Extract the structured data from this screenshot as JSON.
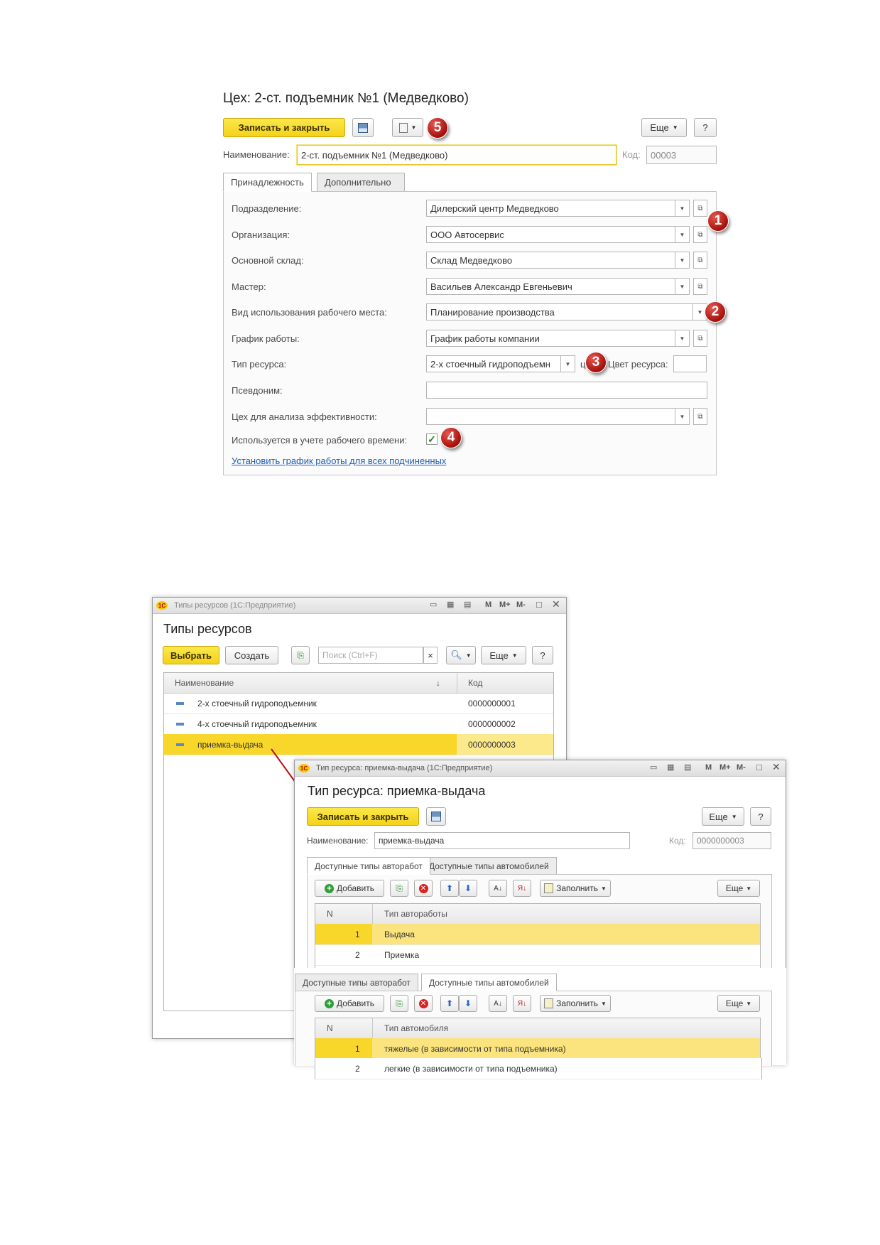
{
  "form1": {
    "title": "Цех: 2-ст. подъемник №1 (Медведково)",
    "save_close_label": "Записать и закрыть",
    "more_label": "Еще",
    "help_label": "?",
    "name_label": "Наименование:",
    "name_value": "2-ст. подъемник №1 (Медведково)",
    "code_label": "Код:",
    "code_value": "00003",
    "tabs": [
      "Принадлежность",
      "Дополнительно"
    ],
    "fields": [
      {
        "label": "Подразделение:",
        "value": "Дилерский центр Медведково"
      },
      {
        "label": "Организация:",
        "value": "ООО Автосервис"
      },
      {
        "label": "Основной склад:",
        "value": "Склад Медведково"
      },
      {
        "label": "Мастер:",
        "value": "Васильев Александр Евгеньевич"
      },
      {
        "label": "Вид использования рабочего места:",
        "value": "Планирование производства"
      },
      {
        "label": "График работы:",
        "value": "График работы компании"
      },
      {
        "label": "Тип ресурса:",
        "value": "2-х стоечный гидроподъемн"
      },
      {
        "label": "Псевдоним:",
        "value": ""
      },
      {
        "label": "Цех для анализа эффективности:",
        "value": ""
      }
    ],
    "color_label": "Цвет ресурса:",
    "color_prefix": "ц",
    "checkbox_label": "Используется в учете рабочего времени:",
    "checkbox_checked": true,
    "link_label": "Установить график работы для всех подчиненных",
    "badges": [
      "1",
      "2",
      "3",
      "4",
      "5"
    ]
  },
  "win1": {
    "titlebar": "Типы ресурсов  (1С:Предприятие)",
    "title": "Типы ресурсов",
    "choose_label": "Выбрать",
    "create_label": "Создать",
    "search_placeholder": "Поиск (Ctrl+F)",
    "clear_glyph": "×",
    "more_label": "Еще",
    "help_label": "?",
    "col_name": "Наименование",
    "col_code": "Код",
    "sort_glyph": "↓",
    "rows": [
      {
        "name": "2-х стоечный гидроподъемник",
        "code": "0000000001"
      },
      {
        "name": "4-х стоечный гидроподъемник",
        "code": "0000000002"
      },
      {
        "name": "приемка-выдача",
        "code": "0000000003"
      }
    ],
    "tb_icons": [
      "M",
      "M+",
      "M-"
    ]
  },
  "win2": {
    "titlebar": "Тип ресурса: приемка-выдача  (1С:Предприятие)",
    "title": "Тип ресурса: приемка-выдача",
    "save_close_label": "Записать и закрыть",
    "more_label": "Еще",
    "help_label": "?",
    "name_label": "Наименование:",
    "name_value": "приемка-выдача",
    "code_label": "Код:",
    "code_value": "0000000003",
    "tabs": [
      "Доступные типы авторабот",
      "Доступные типы автомобилей"
    ],
    "add_label": "Добавить",
    "fill_label": "Заполнить",
    "col_n": "N",
    "col_work": "Тип авторaботы",
    "col_car": "Тип автомобиля",
    "works": [
      {
        "n": "1",
        "name": "Выдача"
      },
      {
        "n": "2",
        "name": "Приемка"
      }
    ],
    "cars": [
      {
        "n": "1",
        "name": "тяжелые (в зависимости от типа подъемника)"
      },
      {
        "n": "2",
        "name": "легкие (в зависимости от типа подъемника)"
      }
    ],
    "tb_icons": [
      "M",
      "M+",
      "M-"
    ]
  }
}
